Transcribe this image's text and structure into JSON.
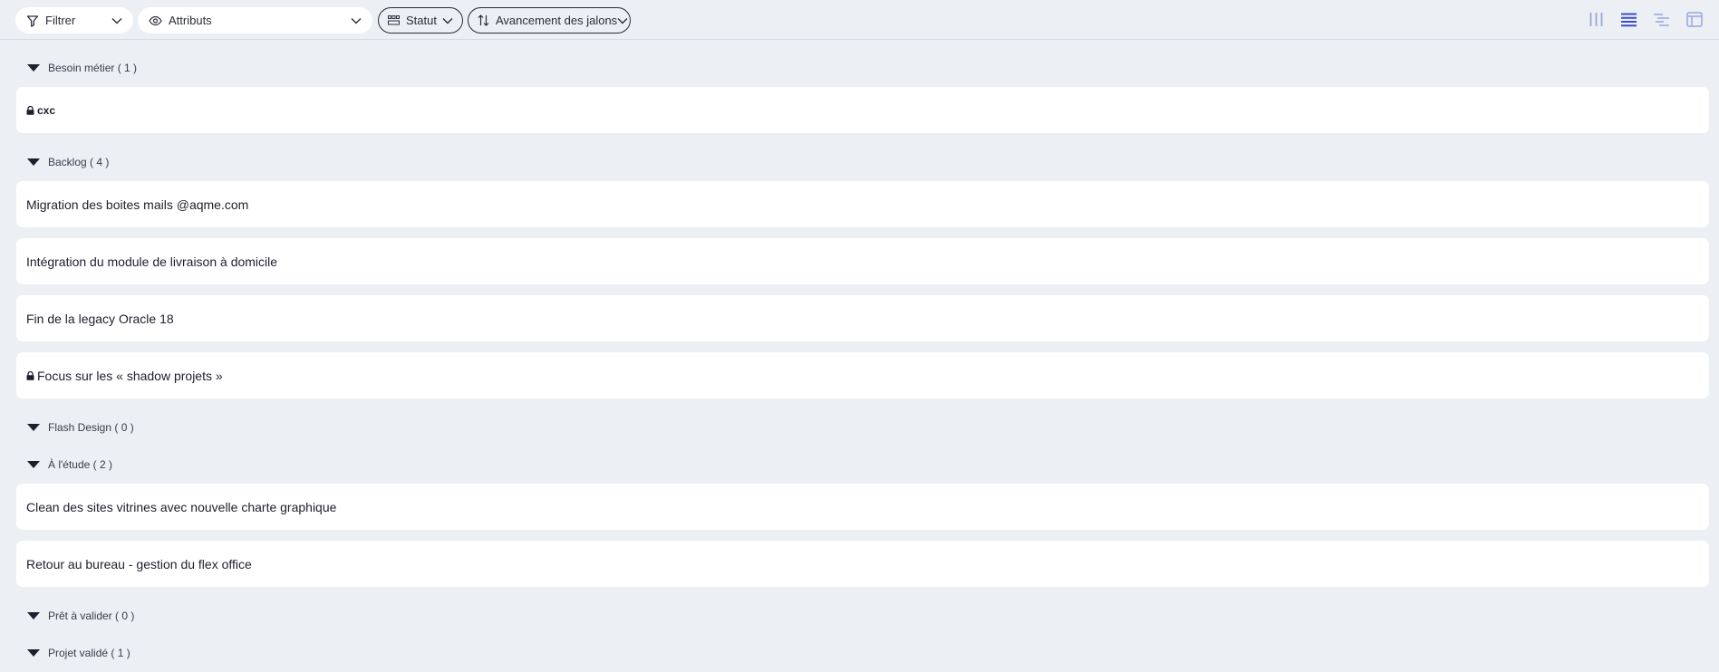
{
  "toolbar": {
    "filter_label": "Filtrer",
    "attributes_label": "Attributs",
    "status_label": "Statut",
    "sort_label": "Avancement des jalons",
    "views": [
      "columns-view-icon",
      "list-view-icon",
      "gantt-view-icon",
      "board-view-icon"
    ],
    "active_view": "list-view-icon",
    "accent_color": "#3b4fc9"
  },
  "groups": [
    {
      "header": "Besoin métier ( 1 )",
      "items": [
        {
          "title": "cxc",
          "locked": true
        }
      ]
    },
    {
      "header": "Backlog ( 4 )",
      "items": [
        {
          "title": "Migration des boites mails @aqme.com",
          "locked": false
        },
        {
          "title": "Intégration du module de livraison à domicile",
          "locked": false
        },
        {
          "title": "Fin de la legacy Oracle 18",
          "locked": false
        },
        {
          "title": "Focus sur les « shadow projets »",
          "locked": true
        }
      ]
    },
    {
      "header": "Flash Design ( 0 )",
      "items": []
    },
    {
      "header": "À l'étude ( 2 )",
      "items": [
        {
          "title": "Clean des sites vitrines avec nouvelle charte graphique",
          "locked": false
        },
        {
          "title": "Retour au bureau - gestion du flex office",
          "locked": false
        }
      ]
    },
    {
      "header": "Prêt à valider ( 0 )",
      "items": []
    },
    {
      "header": "Projet validé ( 1 )",
      "items": []
    }
  ]
}
